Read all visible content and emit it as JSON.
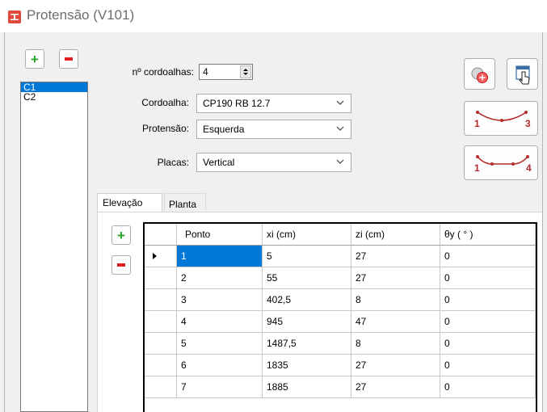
{
  "window": {
    "title": "Protensão (V101)"
  },
  "list": {
    "items": [
      "C1",
      "C2"
    ],
    "selected_index": 0
  },
  "form": {
    "cordoalhas_label": "nº cordoalhas:",
    "cordoalhas_value": "4",
    "cordoalha_label": "Cordoalha:",
    "cordoalha_value": "CP190 RB 12.7",
    "protensao_label": "Protensão:",
    "protensao_value": "Esquerda",
    "placas_label": "Placas:",
    "placas_value": "Vertical"
  },
  "right_buttons": {
    "shape3_left": "1",
    "shape3_right": "3",
    "shape4_left": "1",
    "shape4_right": "4"
  },
  "tabs": {
    "elevacao": "Elevação",
    "planta": "Planta",
    "active": "elevacao"
  },
  "table": {
    "headers": [
      "Ponto",
      "xi (cm)",
      "zi (cm)",
      "θy ( ° )"
    ],
    "rows": [
      [
        "1",
        "5",
        "27",
        "0"
      ],
      [
        "2",
        "55",
        "27",
        "0"
      ],
      [
        "3",
        "402,5",
        "8",
        "0"
      ],
      [
        "4",
        "945",
        "47",
        "0"
      ],
      [
        "5",
        "1487,5",
        "8",
        "0"
      ],
      [
        "6",
        "1835",
        "27",
        "0"
      ],
      [
        "7",
        "1885",
        "27",
        "0"
      ]
    ],
    "current_row": 0
  },
  "colors": {
    "accent": "#0078d7",
    "add_green": "#27a327",
    "remove_red": "#e02020",
    "app_icon": "#e0493a",
    "curve": "#b52a2a"
  }
}
